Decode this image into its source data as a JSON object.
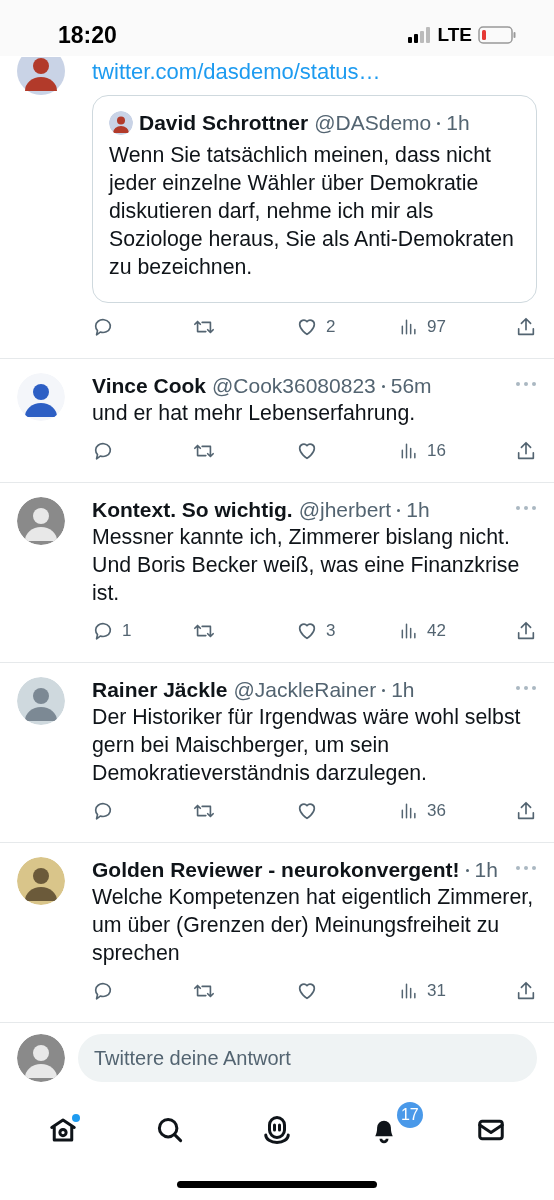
{
  "status_bar": {
    "time": "18:20",
    "network": "LTE"
  },
  "tweets": [
    {
      "kind": "parent",
      "link": "twitter.com/dasdemo/status…",
      "quote": {
        "name": "David Schrottner",
        "handle": "@DASdemo",
        "time": "1h",
        "text": "Wenn Sie tatsächlich meinen, dass nicht jeder einzelne Wähler über Demokratie diskutieren darf, nehme ich mir als Soziologe heraus, Sie als Anti-Demokraten zu bezeichnen."
      },
      "likes": "2",
      "views": "97"
    },
    {
      "kind": "reply",
      "name": "Vince Cook",
      "handle": "@Cook36080823",
      "time": "56m",
      "text": "und er hat mehr Lebenserfahrung.",
      "views": "16"
    },
    {
      "kind": "reply",
      "name": "Kontext. So wichtig.",
      "handle": "@jherbert",
      "time": "1h",
      "text": "Messner kannte ich, Zimmerer bislang nicht. Und Boris Becker weiß, was eine Finanzkrise ist.",
      "replies": "1",
      "likes": "3",
      "views": "42"
    },
    {
      "kind": "reply",
      "name": "Rainer Jäckle",
      "handle": "@JackleRainer",
      "time": "1h",
      "text": "Der Historiker für Irgendwas wäre wohl selbst gern bei Maischberger, um sein Demokratieverständnis darzulegen.",
      "views": "36"
    },
    {
      "kind": "reply",
      "name": "Golden Reviewer - neurokonvergent!",
      "time": "1h",
      "text": "Welche Kompetenzen hat eigentlich Zimmerer, um über (Grenzen der) Meinungsfreiheit zu sprechen",
      "views": "31"
    }
  ],
  "reply_bar": {
    "placeholder": "Twittere deine Antwort"
  },
  "nav": [
    {
      "kind": "home",
      "dot": true
    },
    {
      "kind": "search"
    },
    {
      "kind": "spaces"
    },
    {
      "kind": "notifications",
      "badge": "17"
    },
    {
      "kind": "messages"
    }
  ]
}
